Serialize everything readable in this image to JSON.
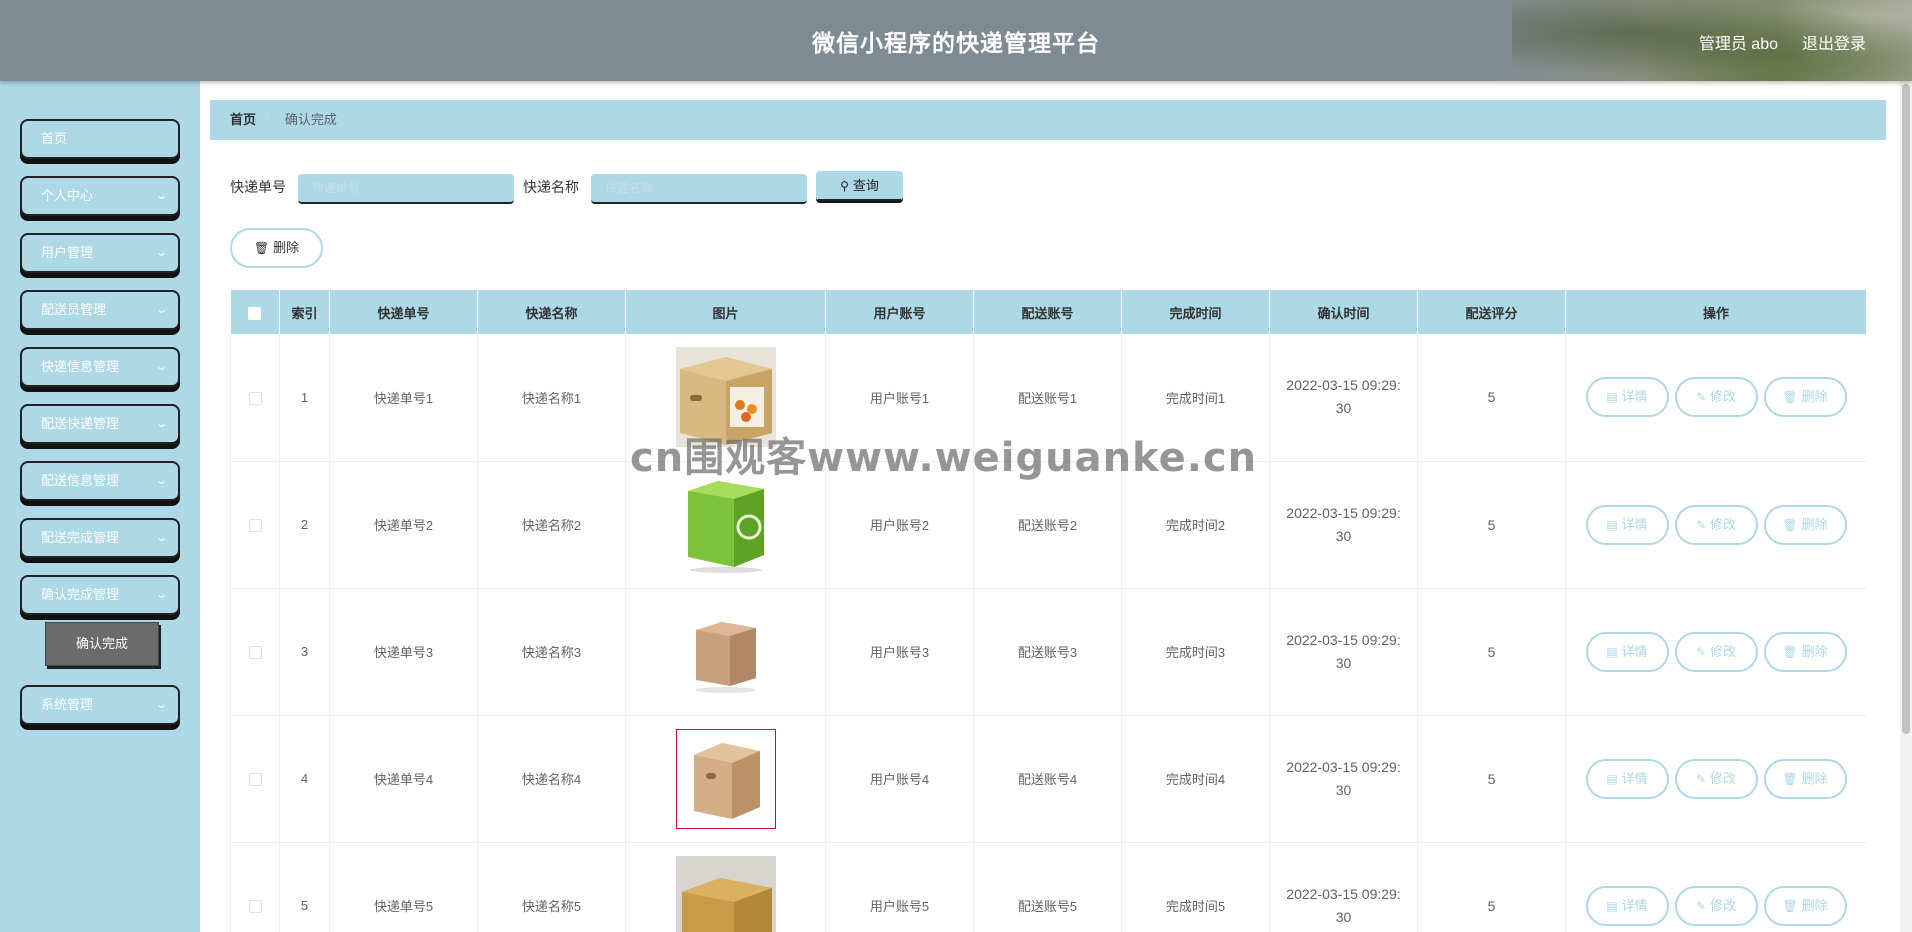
{
  "header": {
    "title": "微信小程序的快递管理平台",
    "user": "管理员 abo",
    "logout": "退出登录"
  },
  "sidebar": {
    "items": [
      {
        "label": "首页"
      },
      {
        "label": "个人中心"
      },
      {
        "label": "用户管理"
      },
      {
        "label": "配送员管理"
      },
      {
        "label": "快递信息管理"
      },
      {
        "label": "配送快递管理"
      },
      {
        "label": "配送信息管理"
      },
      {
        "label": "配送完成管理"
      },
      {
        "label": "确认完成管理"
      },
      {
        "label": "系统管理"
      }
    ],
    "active_sub": "确认完成"
  },
  "breadcrumb": {
    "home": "首页",
    "separator": "/",
    "current": "确认完成"
  },
  "search": {
    "field1_label": "快递单号",
    "field1_placeholder": "快递单号",
    "field2_label": "快递名称",
    "field2_placeholder": "快递名称",
    "query_label": "查询"
  },
  "actions": {
    "delete_label": "删除"
  },
  "table": {
    "headers": [
      "索引",
      "快递单号",
      "快递名称",
      "图片",
      "用户账号",
      "配送账号",
      "完成时间",
      "确认时间",
      "配送评分",
      "操作"
    ],
    "rows": [
      {
        "index": "1",
        "tracking": "快递单号1",
        "name": "快递名称1",
        "user": "用户账号1",
        "courier": "配送账号1",
        "done": "完成时间1",
        "confirm_date": "2022-03-15 09:29:",
        "confirm_sec": "30",
        "score": "5"
      },
      {
        "index": "2",
        "tracking": "快递单号2",
        "name": "快递名称2",
        "user": "用户账号2",
        "courier": "配送账号2",
        "done": "完成时间2",
        "confirm_date": "2022-03-15 09:29:",
        "confirm_sec": "30",
        "score": "5"
      },
      {
        "index": "3",
        "tracking": "快递单号3",
        "name": "快递名称3",
        "user": "用户账号3",
        "courier": "配送账号3",
        "done": "完成时间3",
        "confirm_date": "2022-03-15 09:29:",
        "confirm_sec": "30",
        "score": "5"
      },
      {
        "index": "4",
        "tracking": "快递单号4",
        "name": "快递名称4",
        "user": "用户账号4",
        "courier": "配送账号4",
        "done": "完成时间4",
        "confirm_date": "2022-03-15 09:29:",
        "confirm_sec": "30",
        "score": "5"
      },
      {
        "index": "5",
        "tracking": "快递单号5",
        "name": "快递名称5",
        "user": "用户账号5",
        "courier": "配送账号5",
        "done": "完成时间5",
        "confirm_date": "2022-03-15 09:29:",
        "confirm_sec": "30",
        "score": "5"
      }
    ],
    "row_actions": {
      "detail": "详情",
      "edit": "修改",
      "delete": "删除"
    }
  },
  "watermark": "cn围观客www.weiguanke.cn",
  "colors": {
    "accent": "#add8e6",
    "header": "#7f8b93",
    "submenu": "#6b6b6b"
  }
}
